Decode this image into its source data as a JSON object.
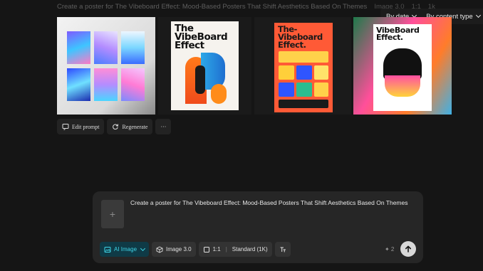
{
  "header": {
    "prompt_preview": "Create a poster for The Vibeboard Effect: Mood-Based Posters That Shift Aesthetics Based On Themes",
    "model_label": "Image 3.0",
    "ratio_label": "1:1",
    "extra_label": "1k"
  },
  "filters": {
    "date_label": "By date",
    "content_label": "By content type"
  },
  "posters": {
    "poster2_title": "The VibeBoard Effect",
    "poster3_title": "The-Vibeboard Effect.",
    "poster4_title": "VibeBoard Effect."
  },
  "actions": {
    "edit_label": "Edit prompt",
    "regenerate_label": "Regenerate",
    "more_label": "···"
  },
  "composer": {
    "prompt_text": "Create a poster for The Vibeboard Effect: Mood-Based Posters That Shift Aesthetics Based On Themes",
    "attach_symbol": "+",
    "mode_label": "AI Image",
    "model_label": "Image 3.0",
    "ratio_label": "1:1",
    "quality_label": "Standard (1K)",
    "credits_label": "✦ 2"
  },
  "colors": {
    "background": "#151515",
    "accent": "#3fd6e8",
    "panel": "#262626"
  }
}
